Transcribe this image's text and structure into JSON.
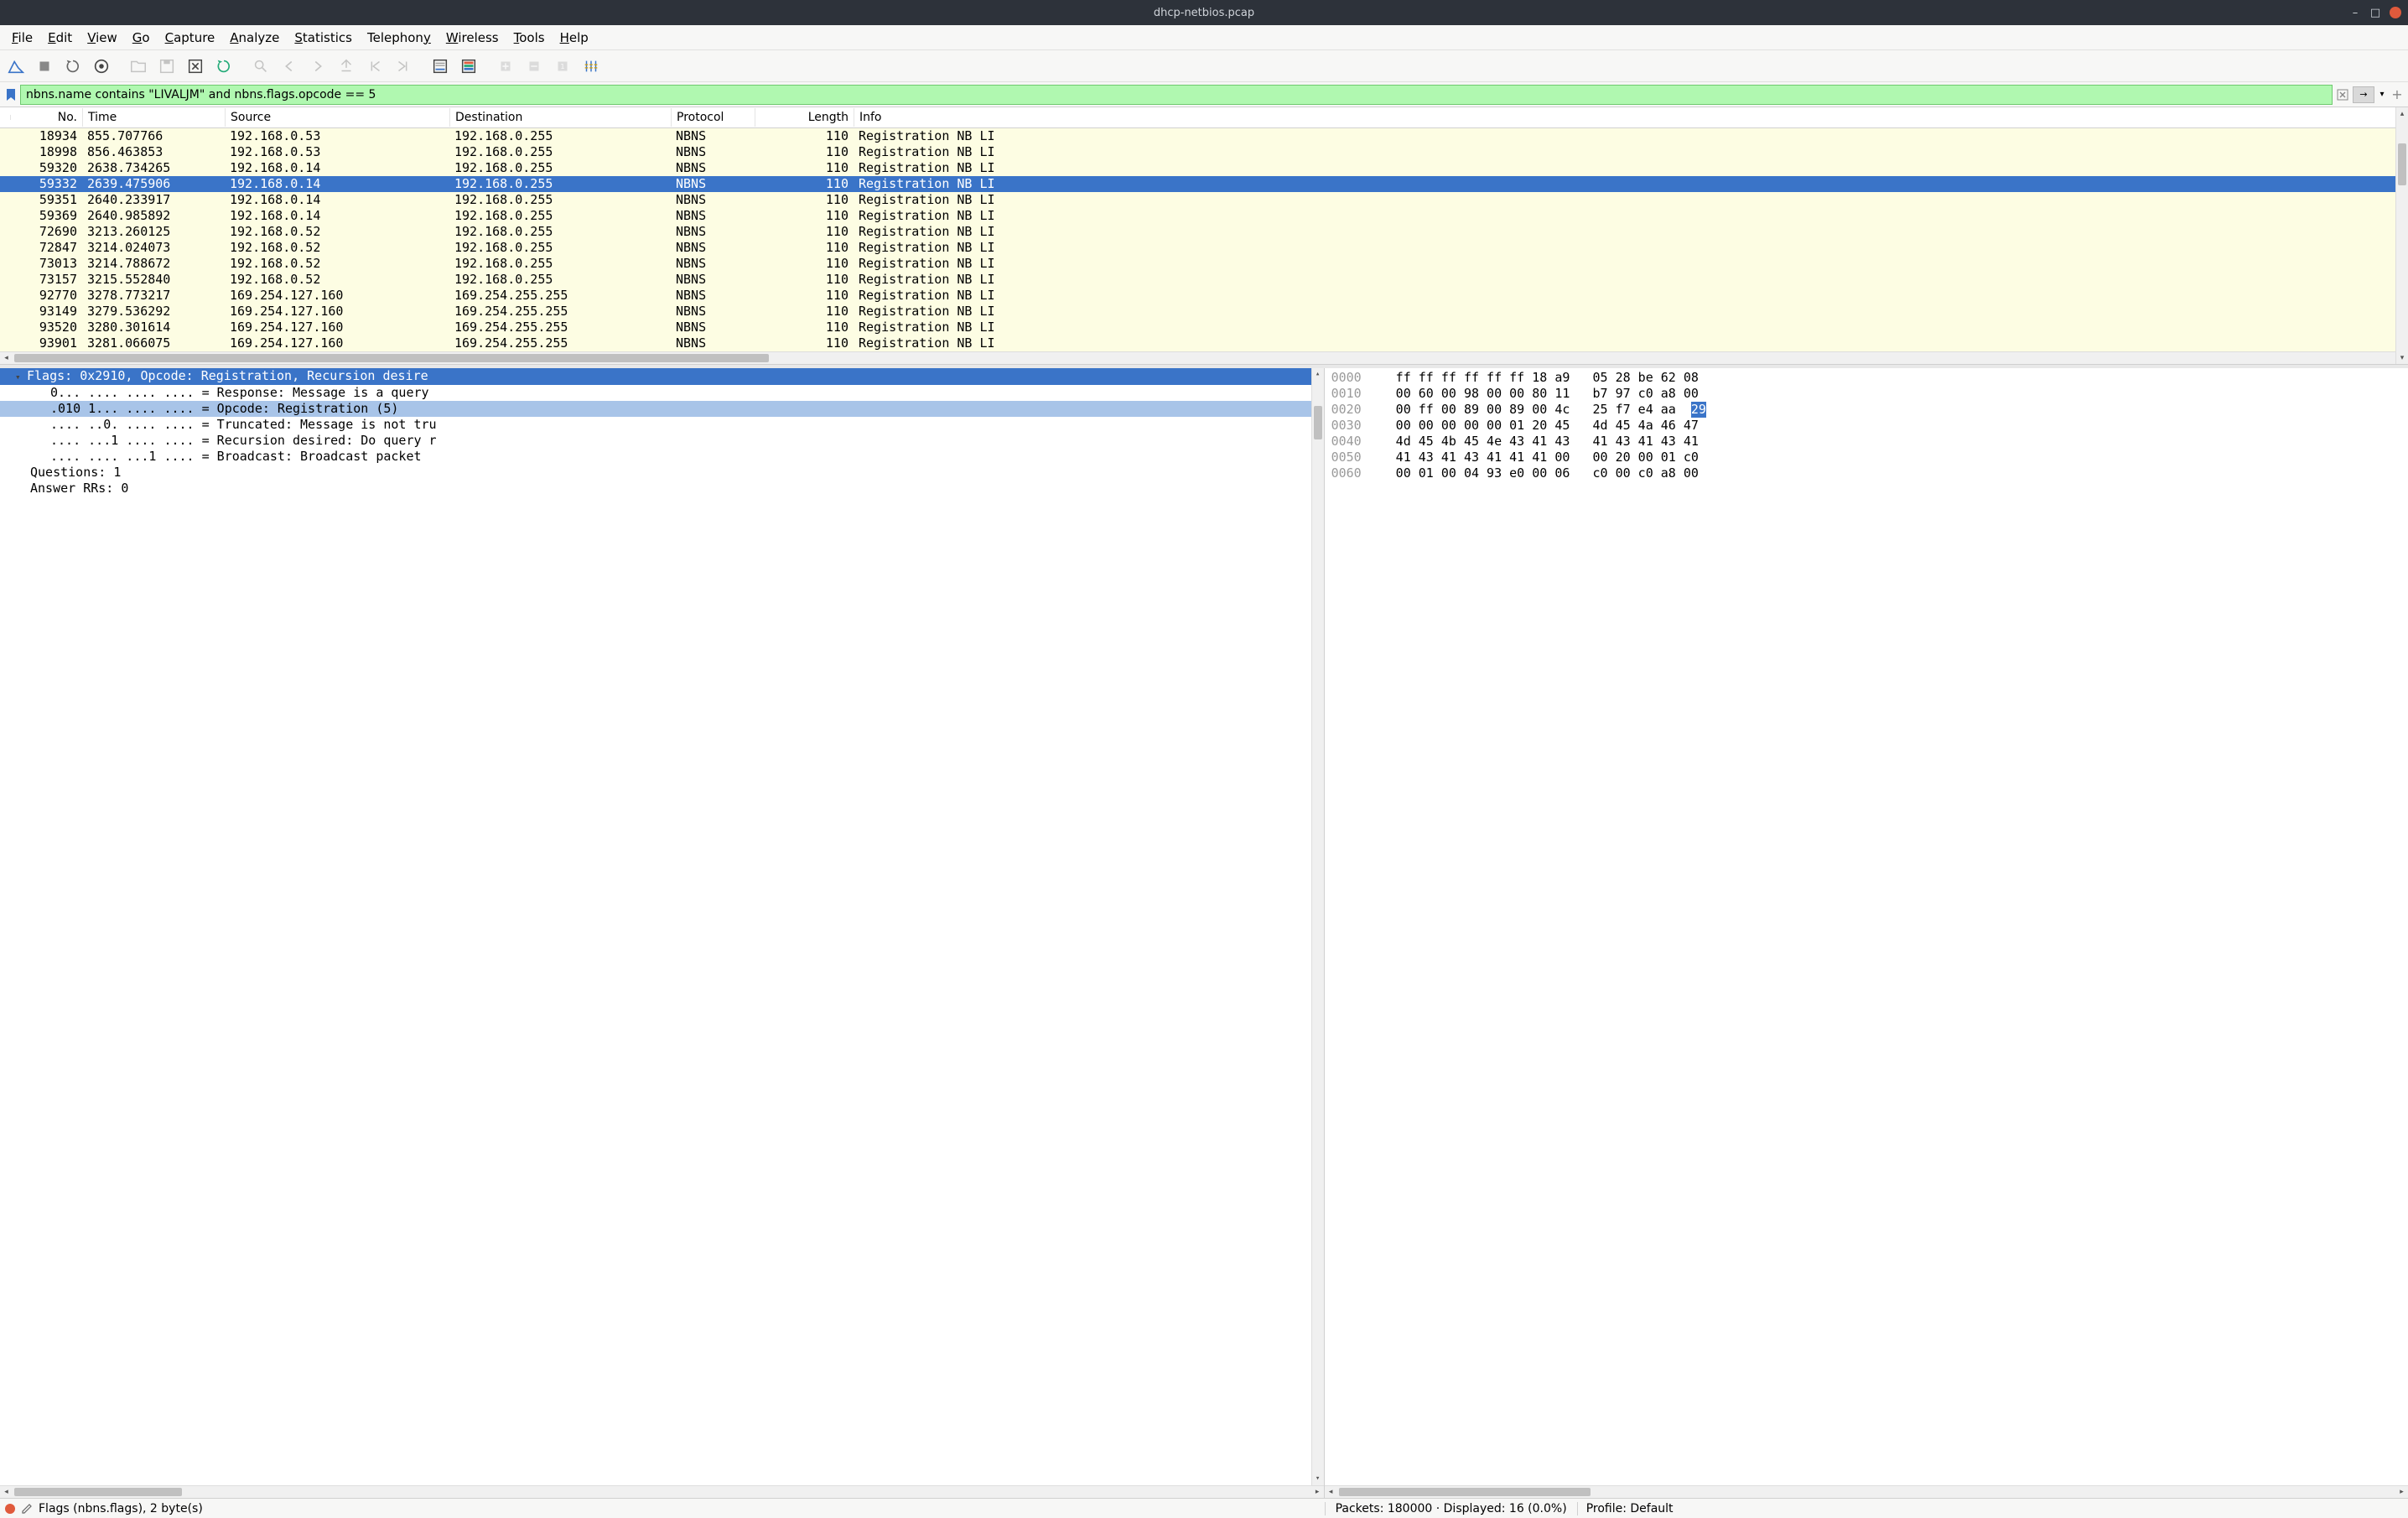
{
  "window": {
    "title": "dhcp-netbios.pcap"
  },
  "menu": {
    "file": "File",
    "edit": "Edit",
    "view": "View",
    "go": "Go",
    "capture": "Capture",
    "analyze": "Analyze",
    "statistics": "Statistics",
    "telephony": "Telephony",
    "wireless": "Wireless",
    "tools": "Tools",
    "help": "Help"
  },
  "filter": {
    "value": "nbns.name contains \"LIVALJM\" and nbns.flags.opcode == 5"
  },
  "columns": {
    "no": "No.",
    "time": "Time",
    "source": "Source",
    "destination": "Destination",
    "protocol": "Protocol",
    "length": "Length",
    "info": "Info"
  },
  "packets": [
    {
      "no": "18934",
      "time": "855.707766",
      "src": "192.168.0.53",
      "dst": "192.168.0.255",
      "proto": "NBNS",
      "len": "110",
      "info": "Registration NB LI",
      "sel": false
    },
    {
      "no": "18998",
      "time": "856.463853",
      "src": "192.168.0.53",
      "dst": "192.168.0.255",
      "proto": "NBNS",
      "len": "110",
      "info": "Registration NB LI",
      "sel": false
    },
    {
      "no": "59320",
      "time": "2638.734265",
      "src": "192.168.0.14",
      "dst": "192.168.0.255",
      "proto": "NBNS",
      "len": "110",
      "info": "Registration NB LI",
      "sel": false
    },
    {
      "no": "59332",
      "time": "2639.475906",
      "src": "192.168.0.14",
      "dst": "192.168.0.255",
      "proto": "NBNS",
      "len": "110",
      "info": "Registration NB LI",
      "sel": true
    },
    {
      "no": "59351",
      "time": "2640.233917",
      "src": "192.168.0.14",
      "dst": "192.168.0.255",
      "proto": "NBNS",
      "len": "110",
      "info": "Registration NB LI",
      "sel": false
    },
    {
      "no": "59369",
      "time": "2640.985892",
      "src": "192.168.0.14",
      "dst": "192.168.0.255",
      "proto": "NBNS",
      "len": "110",
      "info": "Registration NB LI",
      "sel": false
    },
    {
      "no": "72690",
      "time": "3213.260125",
      "src": "192.168.0.52",
      "dst": "192.168.0.255",
      "proto": "NBNS",
      "len": "110",
      "info": "Registration NB LI",
      "sel": false
    },
    {
      "no": "72847",
      "time": "3214.024073",
      "src": "192.168.0.52",
      "dst": "192.168.0.255",
      "proto": "NBNS",
      "len": "110",
      "info": "Registration NB LI",
      "sel": false
    },
    {
      "no": "73013",
      "time": "3214.788672",
      "src": "192.168.0.52",
      "dst": "192.168.0.255",
      "proto": "NBNS",
      "len": "110",
      "info": "Registration NB LI",
      "sel": false
    },
    {
      "no": "73157",
      "time": "3215.552840",
      "src": "192.168.0.52",
      "dst": "192.168.0.255",
      "proto": "NBNS",
      "len": "110",
      "info": "Registration NB LI",
      "sel": false
    },
    {
      "no": "92770",
      "time": "3278.773217",
      "src": "169.254.127.160",
      "dst": "169.254.255.255",
      "proto": "NBNS",
      "len": "110",
      "info": "Registration NB LI",
      "sel": false
    },
    {
      "no": "93149",
      "time": "3279.536292",
      "src": "169.254.127.160",
      "dst": "169.254.255.255",
      "proto": "NBNS",
      "len": "110",
      "info": "Registration NB LI",
      "sel": false
    },
    {
      "no": "93520",
      "time": "3280.301614",
      "src": "169.254.127.160",
      "dst": "169.254.255.255",
      "proto": "NBNS",
      "len": "110",
      "info": "Registration NB LI",
      "sel": false
    },
    {
      "no": "93901",
      "time": "3281.066075",
      "src": "169.254.127.160",
      "dst": "169.254.255.255",
      "proto": "NBNS",
      "len": "110",
      "info": "Registration NB LI",
      "sel": false
    }
  ],
  "details": {
    "flags_header": "Flags: 0x2910, Opcode: Registration, Recursion desire",
    "response": "0... .... .... .... = Response: Message is a query",
    "opcode": ".010 1... .... .... = Opcode: Registration (5)",
    "truncated": ".... ..0. .... .... = Truncated: Message is not tru",
    "recursion": ".... ...1 .... .... = Recursion desired: Do query r",
    "broadcast": ".... .... ...1 .... = Broadcast: Broadcast packet",
    "questions": "Questions: 1",
    "answer_rrs": "Answer RRs: 0"
  },
  "hex": [
    {
      "off": "0000",
      "a": "ff ff ff ff ff ff 18 a9",
      "b": "05 28 be 62 08"
    },
    {
      "off": "0010",
      "a": "00 60 00 98 00 00 80 11",
      "b": "b7 97 c0 a8 00"
    },
    {
      "off": "0020",
      "a": "00 ff 00 89 00 89 00 4c",
      "b": "25 f7 e4 aa ",
      "sel": "29"
    },
    {
      "off": "0030",
      "a": "00 00 00 00 00 01 20 45",
      "b": "4d 45 4a 46 47"
    },
    {
      "off": "0040",
      "a": "4d 45 4b 45 4e 43 41 43",
      "b": "41 43 41 43 41"
    },
    {
      "off": "0050",
      "a": "41 43 41 43 41 41 41 00",
      "b": "00 20 00 01 c0"
    },
    {
      "off": "0060",
      "a": "00 01 00 04 93 e0 00 06",
      "b": "c0 00 c0 a8 00"
    }
  ],
  "status": {
    "field": "Flags (nbns.flags), 2 byte(s)",
    "packets": "Packets: 180000 · Displayed: 16 (0.0%)",
    "profile": "Profile: Default"
  }
}
